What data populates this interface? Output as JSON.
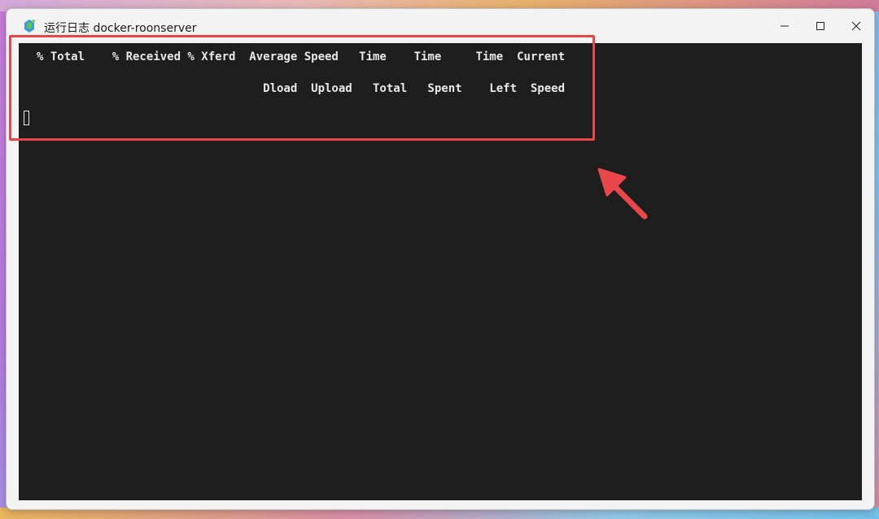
{
  "window": {
    "title": "运行日志 docker-roonserver",
    "controls": {
      "minimize_glyph": "—",
      "maximize_glyph": "☐",
      "close_glyph": "✕"
    }
  },
  "terminal": {
    "header_line_1": "% Total    % Received % Xferd  Average Speed   Time    Time     Time  Current",
    "header_line_2": "                                 Dload  Upload   Total   Spent    Left  Speed"
  },
  "annotation": {
    "highlight_color": "#e8464a",
    "arrow_color": "#e8464a"
  }
}
